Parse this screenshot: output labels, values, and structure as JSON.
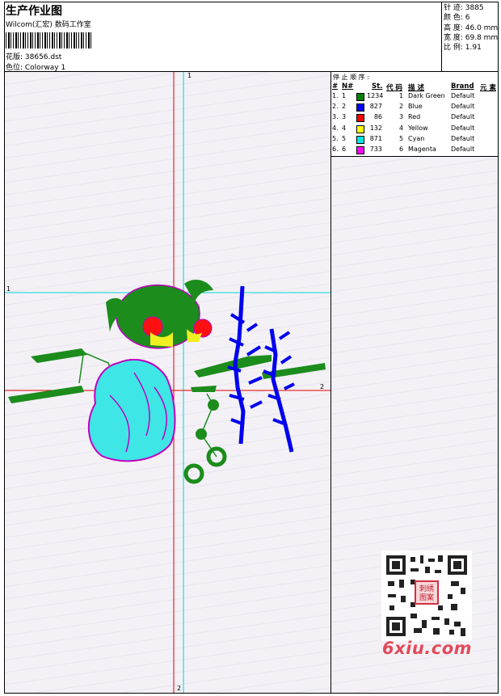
{
  "header": {
    "title": "生产作业图",
    "subtitle": "Wilcom(汇宏) 数码工作室",
    "design_label": "花版: 38656.dst",
    "colorway_label": "色位:  Colorway 1"
  },
  "stats": {
    "stitches": "针 迹:  3885",
    "colors": "颜 色:  6",
    "height": "高 度:  46.0 mm",
    "width": "宽 度:  69.8 mm",
    "scale": "比 例:  1.91"
  },
  "stop_sequence": {
    "title": "停 止 顺 序 :",
    "headers": [
      "#",
      "N#",
      "St.",
      "代 码",
      "描 述",
      "Brand",
      "元 素"
    ],
    "rows": [
      {
        "idx": "1.",
        "n": "1",
        "stitches": "1234",
        "code": "1",
        "desc": "Dark Green",
        "brand": "Default",
        "color": "#008000"
      },
      {
        "idx": "2.",
        "n": "2",
        "stitches": "827",
        "code": "2",
        "desc": "Blue",
        "brand": "Default",
        "color": "#0000ff"
      },
      {
        "idx": "3.",
        "n": "3",
        "stitches": "86",
        "code": "3",
        "desc": "Red",
        "brand": "Default",
        "color": "#ff0000"
      },
      {
        "idx": "4.",
        "n": "4",
        "stitches": "132",
        "code": "4",
        "desc": "Yellow",
        "brand": "Default",
        "color": "#ffff00"
      },
      {
        "idx": "5.",
        "n": "5",
        "stitches": "871",
        "code": "5",
        "desc": "Cyan",
        "brand": "Default",
        "color": "#00e5e5"
      },
      {
        "idx": "6.",
        "n": "6",
        "stitches": "733",
        "code": "6",
        "desc": "Magenta",
        "brand": "Default",
        "color": "#ff00ff"
      }
    ]
  },
  "axes": {
    "cyan_top": "1",
    "cyan_left": "1",
    "red_right": "2",
    "red_bottom": "2"
  },
  "watermark": {
    "text": "6xiu.com",
    "stamp": "刺绣图案"
  }
}
